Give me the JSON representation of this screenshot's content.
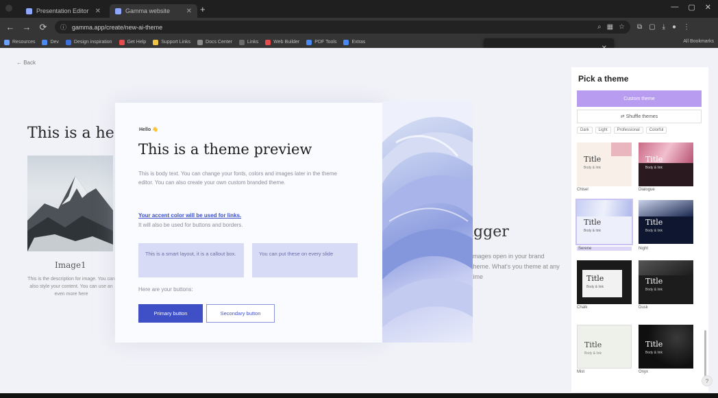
{
  "browser": {
    "tabs": [
      {
        "title": "Presentation Editor",
        "active": false
      },
      {
        "title": "Gamma website",
        "active": true
      }
    ],
    "new_tab": "+",
    "window_controls": [
      "—",
      "▢",
      "✕"
    ],
    "url": "gamma.app/create/new-ai-theme",
    "nav": {
      "back": "←",
      "forward": "→",
      "reload": "⟳"
    },
    "bookmarks": [
      {
        "label": "Resources",
        "color": "#6ea0ff"
      },
      {
        "label": "Dev",
        "color": "#4a89f3"
      },
      {
        "label": "Design inspiration",
        "color": "#3d6fdb"
      },
      {
        "label": "Get Help",
        "color": "#e84b4b"
      },
      {
        "label": "Support Links",
        "color": "#f2c443"
      },
      {
        "label": "Docs Center",
        "color": "#8b8b8b"
      },
      {
        "label": "Links",
        "color": "#6b6b6b"
      },
      {
        "label": "Web Builder",
        "color": "#e84b4b"
      },
      {
        "label": "PDF Tools",
        "color": "#4a89f3"
      },
      {
        "label": "Extras",
        "color": "#4a89f3"
      }
    ],
    "other_bookmarks": "All Bookmarks"
  },
  "page": {
    "back_link": "← Back",
    "background": {
      "heading": "This is a he",
      "image_caption": "Image1",
      "image_desc": "This is the description for image. You can also style your content. You can use an even more here",
      "bigger_heading": "igger",
      "bigger_text": "images open in your brand theme. What's you theme at any time"
    },
    "preview_card": {
      "eyebrow": "Hello 👋",
      "title": "This is a theme preview",
      "body": "This is body text. You can change your fonts, colors and images later in the theme editor. You can also create your own custom branded theme.",
      "link_text": "Your accent color will be used for links.",
      "link_sub": "It will also be used for buttons and borders.",
      "callout_1": "This is a smart layout, it is a callout box.",
      "callout_2": "You can put these on every slide",
      "buttons_label": "Here are your buttons:",
      "primary_button": "Primary button",
      "secondary_button": "Secondary button"
    },
    "picker": {
      "title": "Pick a theme",
      "custom_theme_button": "Custom theme",
      "shuffle_button": "⇄ Shuffle themes",
      "filters": [
        "Dark",
        "Light",
        "Professional",
        "Colorful"
      ],
      "themes": [
        {
          "name": "Chisel",
          "tile_title": "Title",
          "tile_sub": "Body & link",
          "bg": "#f7efe8",
          "fg": "#333"
        },
        {
          "name": "Dialogue",
          "tile_title": "Title",
          "tile_sub": "Body & link",
          "bg": "#2a1a1f",
          "fg": "#fff"
        },
        {
          "name": "Serene",
          "tile_title": "Title",
          "tile_sub": "Body & link",
          "bg": "#edf0fb",
          "fg": "#333"
        },
        {
          "name": "Night",
          "tile_title": "Title",
          "tile_sub": "Body & link",
          "bg": "#0f1730",
          "fg": "#fff"
        },
        {
          "name": "Chalk",
          "tile_title": "Title",
          "tile_sub": "Body & link",
          "bg": "#f2f2f2",
          "fg": "#222"
        },
        {
          "name": "Dusk",
          "tile_title": "Title",
          "tile_sub": "Body & link",
          "bg": "#1c1c1c",
          "fg": "#fff"
        },
        {
          "name": "Mist",
          "tile_title": "Title",
          "tile_sub": "Body & link",
          "bg": "#eef0ea",
          "fg": "#444"
        },
        {
          "name": "Onyx",
          "tile_title": "Title",
          "tile_sub": "Body & link",
          "bg": "#0f0f0f",
          "fg": "#fff"
        }
      ]
    },
    "help": "?"
  }
}
